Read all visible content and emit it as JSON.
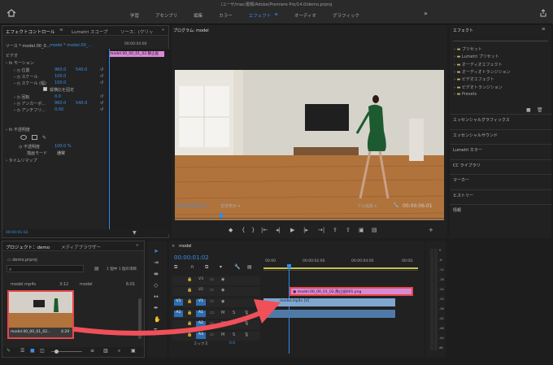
{
  "window": {
    "title": "/ユーザ/mac/書類/Adobe/Premiere Pro/14.0/demo.prproj"
  },
  "workspaces": {
    "items": [
      "学習",
      "アセンブリ",
      "編集",
      "カラー",
      "エフェクト",
      "オーディオ",
      "グラフィック"
    ],
    "active": "エフェクト"
  },
  "effect_controls": {
    "tabs": [
      "エフェクトコントロール",
      "Lumetri スコープ",
      "ソース：(クリッ"
    ],
    "source_label": "ソース * model.00_0...",
    "sequence_label": "model * model.00_...",
    "timecode_ruler": "00:00:04:00",
    "clip_label": "model.00_00_01_02.静止画",
    "video_header": "ビデオ",
    "motion": "モーション",
    "props": [
      {
        "label": "位置",
        "v1": "960.0",
        "v2": "540.0"
      },
      {
        "label": "スケール",
        "v1": "100.0",
        "v2": ""
      },
      {
        "label": "スケール (幅)",
        "v1": "100.0",
        "v2": ""
      },
      {
        "label": "縦横比を固定",
        "v1": "",
        "v2": ""
      },
      {
        "label": "回転",
        "v1": "0.0",
        "v2": ""
      },
      {
        "label": "アンカーポ...",
        "v1": "960.0",
        "v2": "540.0"
      },
      {
        "label": "アンチフリ...",
        "v1": "0.00",
        "v2": ""
      }
    ],
    "opacity": "不透明度",
    "opacity_value": "100.0 %",
    "blend_mode": "描画モード",
    "blend_value": "通常",
    "time_remap": "タイムリマップ",
    "timecode": "00:00:01:02"
  },
  "program": {
    "title": "プログラム: model",
    "timecode": "00:00:01:02",
    "zoom": "全体表示",
    "quality": "フル画質",
    "duration": "00:00:06:01"
  },
  "effects_panel": {
    "title": "エフェクト",
    "tree": [
      "プリセット",
      "Lumetri プリセット",
      "オーディオエフェクト",
      "オーディオトランジション",
      "ビデオエフェクト",
      "ビデオトランジション",
      "Presets"
    ],
    "sections": [
      "エッセンシャルグラフィックス",
      "エッセンシャルサウンド",
      "Lumetri カラー",
      "CC ライブラリ",
      "マーカー",
      "ヒストリー",
      "情報"
    ]
  },
  "project": {
    "tabs": [
      "プロジェクト：demo",
      "メディアブラウザー"
    ],
    "file": "demo.prproj",
    "count": "1 個中 1 個の項目",
    "items": [
      {
        "name": "model.mp4v",
        "dur": "3:12",
        "name2": "model",
        "dur2": "6:01"
      }
    ],
    "thumb_label": "model.00_00_01_02...",
    "thumb_dur": "4:29"
  },
  "timeline": {
    "tab": "model",
    "timecode": "00:00:01:02",
    "ruler": [
      "00:00",
      "00:00:02:00",
      "00:00:04:00",
      "00:00:"
    ],
    "tracks": [
      "V3",
      "V2",
      "V1",
      "A1",
      "A2",
      "A3"
    ],
    "mix": "ミックス",
    "mix_value": "0.0",
    "clip_png": "model.00_00_01_02.静止画001.png",
    "clip_video": "model.mp4v [V]",
    "meter": [
      "0",
      "-6",
      "-12",
      "-18",
      "-24",
      "-30",
      "-36",
      "-42",
      "-48",
      "-54",
      "dB"
    ]
  },
  "colors": {
    "accent": "#2d8ceb",
    "png_clip": "#d88ad5",
    "video_clip": "#7fa6cf",
    "highlight": "#e8474b",
    "arrow": "#f0505a"
  }
}
